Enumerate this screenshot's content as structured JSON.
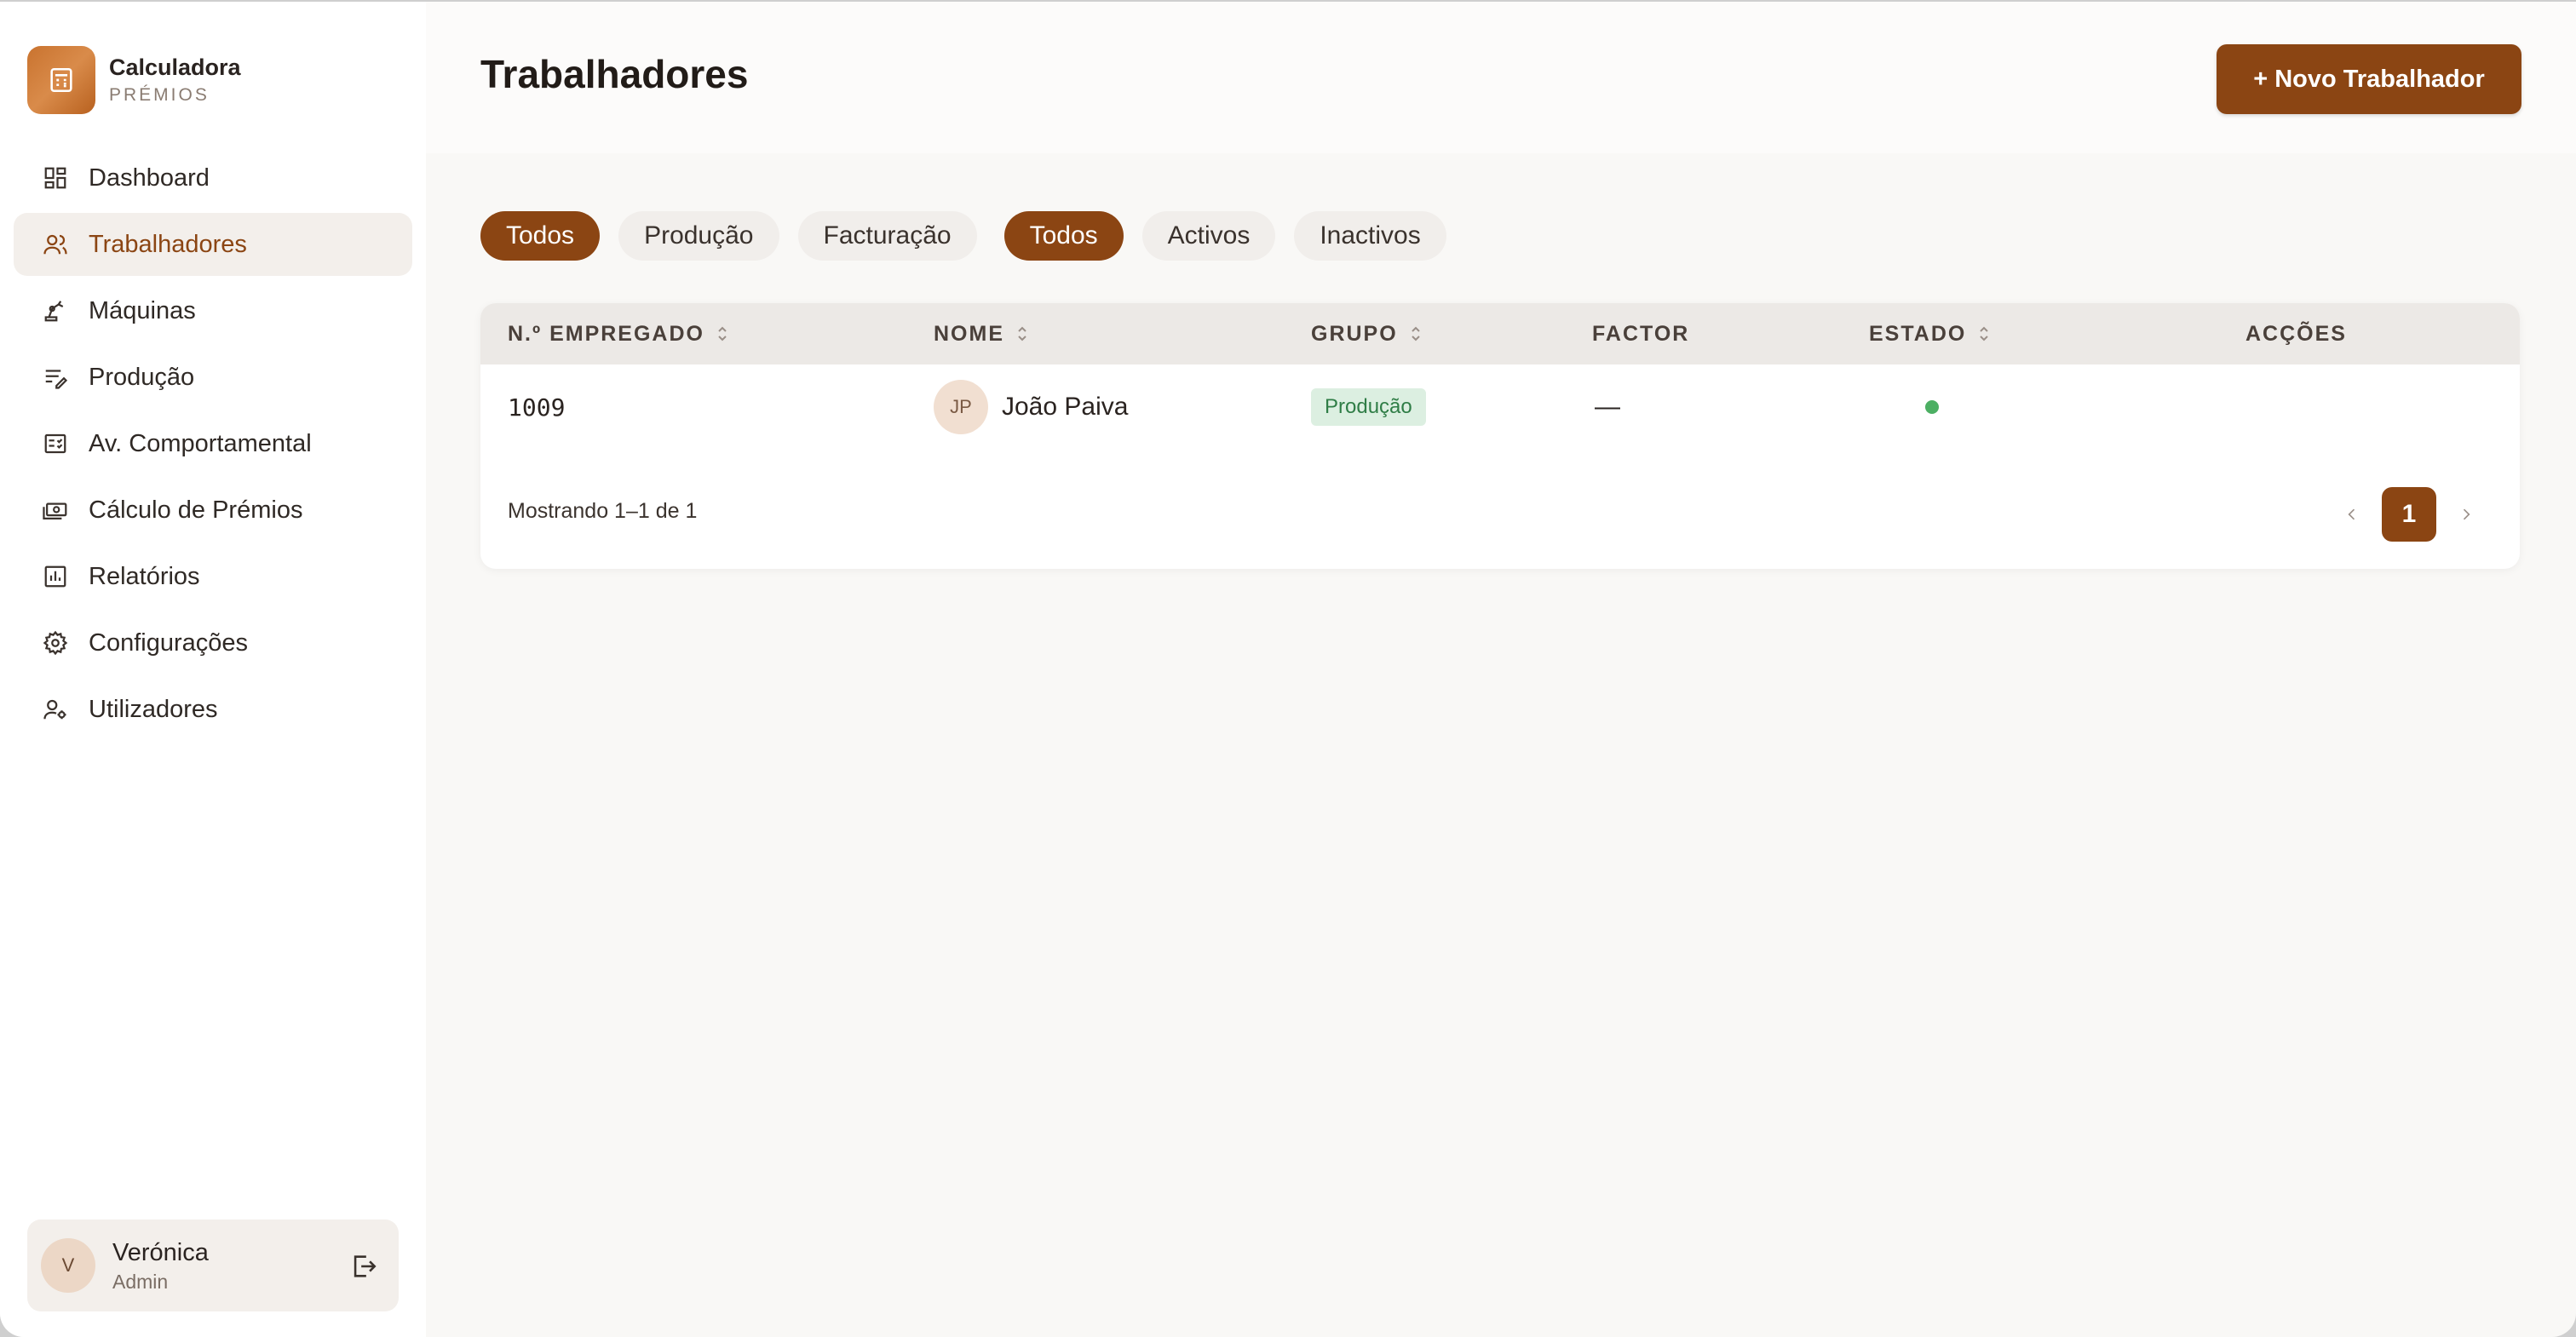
{
  "brand": {
    "name": "Calculadora",
    "subtitle": "PRÉMIOS"
  },
  "sidebar": {
    "items": [
      {
        "label": "Dashboard",
        "icon": "dashboard-icon",
        "active": false
      },
      {
        "label": "Trabalhadores",
        "icon": "users-icon",
        "active": true
      },
      {
        "label": "Máquinas",
        "icon": "machine-icon",
        "active": false
      },
      {
        "label": "Produção",
        "icon": "production-list-icon",
        "active": false
      },
      {
        "label": "Av. Comportamental",
        "icon": "evaluation-icon",
        "active": false
      },
      {
        "label": "Cálculo de Prémios",
        "icon": "money-icon",
        "active": false
      },
      {
        "label": "Relatórios",
        "icon": "bar-chart-icon",
        "active": false
      },
      {
        "label": "Configurações",
        "icon": "gear-icon",
        "active": false
      },
      {
        "label": "Utilizadores",
        "icon": "user-settings-icon",
        "active": false
      }
    ]
  },
  "user": {
    "initial": "V",
    "name": "Verónica",
    "role": "Admin"
  },
  "header": {
    "title": "Trabalhadores",
    "new_button": "+ Novo Trabalhador"
  },
  "filters": {
    "group": [
      "Todos",
      "Produção",
      "Facturação"
    ],
    "status": [
      "Todos",
      "Activos",
      "Inactivos"
    ]
  },
  "table": {
    "columns": {
      "emp_no": "N.º EMPREGADO",
      "name": "NOME",
      "group": "GRUPO",
      "factor": "FACTOR",
      "status": "ESTADO",
      "actions": "ACÇÕES"
    },
    "rows": [
      {
        "emp_no": "1009",
        "initials": "JP",
        "name": "João Paiva",
        "group": "Produção",
        "factor": "—",
        "status": "active"
      }
    ],
    "showing": "Mostrando 1–1 de 1",
    "page": "1"
  },
  "colors": {
    "accent": "#8b4513",
    "active_nav_bg": "#f3efeb",
    "status_active": "#4caf63",
    "badge_bg": "#dcefe1",
    "badge_text": "#2f7d46"
  }
}
